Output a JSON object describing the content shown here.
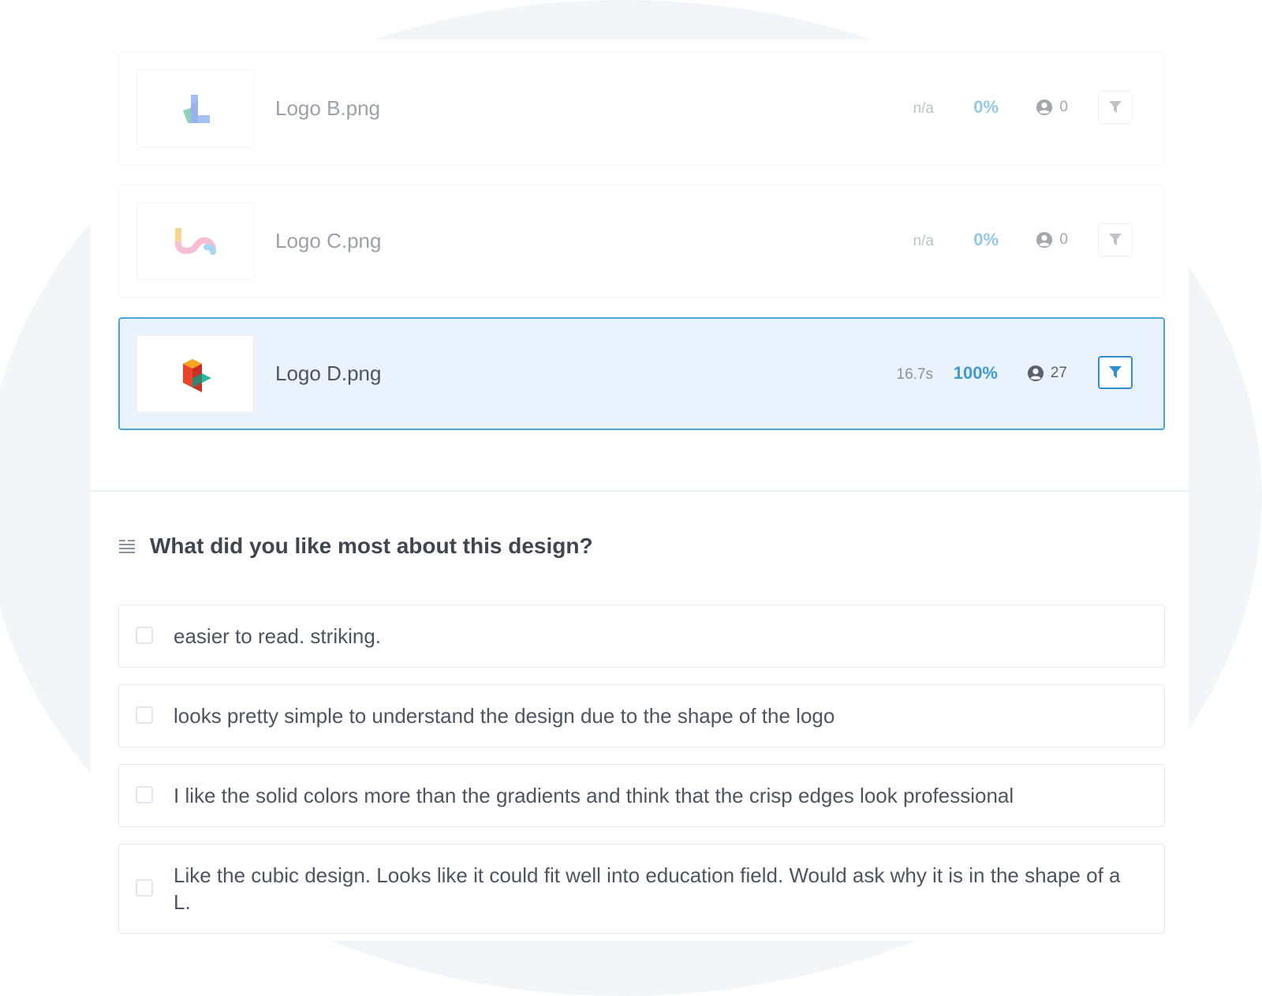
{
  "colors": {
    "accent": "#3f9ad3",
    "selected_border": "#49a5dc",
    "selected_bg": "#eaf3fd",
    "text": "#4d5560"
  },
  "files": [
    {
      "name": "Logo B.png",
      "time": "n/a",
      "percent": "0%",
      "users": "0",
      "logo_icon": "logo-b-icon",
      "selected": false
    },
    {
      "name": "Logo C.png",
      "time": "n/a",
      "percent": "0%",
      "users": "0",
      "logo_icon": "logo-c-icon",
      "selected": false
    },
    {
      "name": "Logo D.png",
      "time": "16.7s",
      "percent": "100%",
      "users": "27",
      "logo_icon": "logo-d-icon",
      "selected": true
    }
  ],
  "question": {
    "icon": "text-lines-icon",
    "title": "What did you like most about this design?"
  },
  "answers": [
    "easier to read. striking.",
    "looks pretty simple to understand the design due to the shape of the logo",
    "I like the solid colors more than the gradients and think that the crisp edges look professional",
    "Like the cubic design. Looks like it could fit well into education field. Would ask why it is in the shape of a L."
  ]
}
